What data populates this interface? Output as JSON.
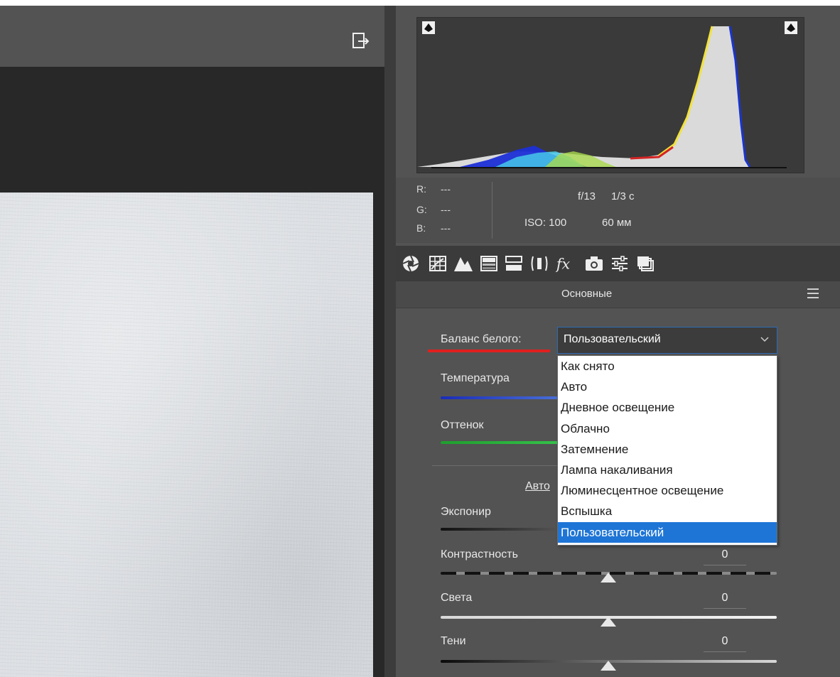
{
  "histogram": {
    "rgb": [
      {
        "label": "R:",
        "value": "---"
      },
      {
        "label": "G:",
        "value": "---"
      },
      {
        "label": "B:",
        "value": "---"
      }
    ],
    "aperture": "f/13",
    "shutter": "1/3 с",
    "iso": "ISO: 100",
    "focal_length": "60 мм"
  },
  "tabs": {
    "icons": [
      "aperture-icon",
      "grid-icon",
      "mountain-icon",
      "gradient-icon",
      "split-icon",
      "lens-icon",
      "fx-icon",
      "camera-icon",
      "sliders-icon",
      "layers-icon"
    ]
  },
  "section": {
    "title": "Основные"
  },
  "white_balance": {
    "label": "Баланс белого:",
    "selected": "Пользовательский",
    "options": [
      "Как снято",
      "Авто",
      "Дневное освещение",
      "Облачно",
      "Затемнение",
      "Лампа накаливания",
      "Люминесцентное освещение",
      "Вспышка",
      "Пользовательский"
    ]
  },
  "controls": {
    "temperature": {
      "label": "Температура"
    },
    "tint": {
      "label": "Оттенок"
    },
    "auto": {
      "label": "Авто"
    },
    "exposure": {
      "label": "Экспонир"
    },
    "contrast": {
      "label": "Контрастность",
      "value": "0"
    },
    "highlights": {
      "label": "Света",
      "value": "0"
    },
    "shadows": {
      "label": "Тени",
      "value": "0"
    }
  },
  "colors": {
    "panel": "#535353",
    "accent_select": "#1e75d6",
    "underline_red": "#e0201e"
  }
}
